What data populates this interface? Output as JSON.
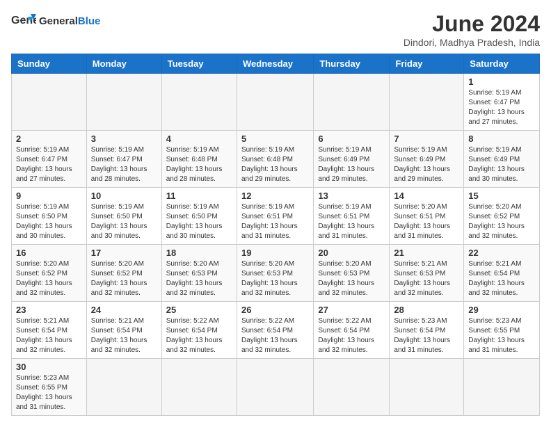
{
  "header": {
    "logo_general": "General",
    "logo_blue": "Blue",
    "month_year": "June 2024",
    "location": "Dindori, Madhya Pradesh, India"
  },
  "days_of_week": [
    "Sunday",
    "Monday",
    "Tuesday",
    "Wednesday",
    "Thursday",
    "Friday",
    "Saturday"
  ],
  "weeks": [
    [
      {
        "day": "",
        "info": ""
      },
      {
        "day": "",
        "info": ""
      },
      {
        "day": "",
        "info": ""
      },
      {
        "day": "",
        "info": ""
      },
      {
        "day": "",
        "info": ""
      },
      {
        "day": "",
        "info": ""
      },
      {
        "day": "1",
        "info": "Sunrise: 5:19 AM\nSunset: 6:47 PM\nDaylight: 13 hours and 27 minutes."
      }
    ],
    [
      {
        "day": "2",
        "info": "Sunrise: 5:19 AM\nSunset: 6:47 PM\nDaylight: 13 hours and 27 minutes."
      },
      {
        "day": "3",
        "info": "Sunrise: 5:19 AM\nSunset: 6:47 PM\nDaylight: 13 hours and 28 minutes."
      },
      {
        "day": "4",
        "info": "Sunrise: 5:19 AM\nSunset: 6:48 PM\nDaylight: 13 hours and 28 minutes."
      },
      {
        "day": "5",
        "info": "Sunrise: 5:19 AM\nSunset: 6:48 PM\nDaylight: 13 hours and 29 minutes."
      },
      {
        "day": "6",
        "info": "Sunrise: 5:19 AM\nSunset: 6:49 PM\nDaylight: 13 hours and 29 minutes."
      },
      {
        "day": "7",
        "info": "Sunrise: 5:19 AM\nSunset: 6:49 PM\nDaylight: 13 hours and 29 minutes."
      },
      {
        "day": "8",
        "info": "Sunrise: 5:19 AM\nSunset: 6:49 PM\nDaylight: 13 hours and 30 minutes."
      }
    ],
    [
      {
        "day": "9",
        "info": "Sunrise: 5:19 AM\nSunset: 6:50 PM\nDaylight: 13 hours and 30 minutes."
      },
      {
        "day": "10",
        "info": "Sunrise: 5:19 AM\nSunset: 6:50 PM\nDaylight: 13 hours and 30 minutes."
      },
      {
        "day": "11",
        "info": "Sunrise: 5:19 AM\nSunset: 6:50 PM\nDaylight: 13 hours and 30 minutes."
      },
      {
        "day": "12",
        "info": "Sunrise: 5:19 AM\nSunset: 6:51 PM\nDaylight: 13 hours and 31 minutes."
      },
      {
        "day": "13",
        "info": "Sunrise: 5:19 AM\nSunset: 6:51 PM\nDaylight: 13 hours and 31 minutes."
      },
      {
        "day": "14",
        "info": "Sunrise: 5:20 AM\nSunset: 6:51 PM\nDaylight: 13 hours and 31 minutes."
      },
      {
        "day": "15",
        "info": "Sunrise: 5:20 AM\nSunset: 6:52 PM\nDaylight: 13 hours and 32 minutes."
      }
    ],
    [
      {
        "day": "16",
        "info": "Sunrise: 5:20 AM\nSunset: 6:52 PM\nDaylight: 13 hours and 32 minutes."
      },
      {
        "day": "17",
        "info": "Sunrise: 5:20 AM\nSunset: 6:52 PM\nDaylight: 13 hours and 32 minutes."
      },
      {
        "day": "18",
        "info": "Sunrise: 5:20 AM\nSunset: 6:53 PM\nDaylight: 13 hours and 32 minutes."
      },
      {
        "day": "19",
        "info": "Sunrise: 5:20 AM\nSunset: 6:53 PM\nDaylight: 13 hours and 32 minutes."
      },
      {
        "day": "20",
        "info": "Sunrise: 5:20 AM\nSunset: 6:53 PM\nDaylight: 13 hours and 32 minutes."
      },
      {
        "day": "21",
        "info": "Sunrise: 5:21 AM\nSunset: 6:53 PM\nDaylight: 13 hours and 32 minutes."
      },
      {
        "day": "22",
        "info": "Sunrise: 5:21 AM\nSunset: 6:54 PM\nDaylight: 13 hours and 32 minutes."
      }
    ],
    [
      {
        "day": "23",
        "info": "Sunrise: 5:21 AM\nSunset: 6:54 PM\nDaylight: 13 hours and 32 minutes."
      },
      {
        "day": "24",
        "info": "Sunrise: 5:21 AM\nSunset: 6:54 PM\nDaylight: 13 hours and 32 minutes."
      },
      {
        "day": "25",
        "info": "Sunrise: 5:22 AM\nSunset: 6:54 PM\nDaylight: 13 hours and 32 minutes."
      },
      {
        "day": "26",
        "info": "Sunrise: 5:22 AM\nSunset: 6:54 PM\nDaylight: 13 hours and 32 minutes."
      },
      {
        "day": "27",
        "info": "Sunrise: 5:22 AM\nSunset: 6:54 PM\nDaylight: 13 hours and 32 minutes."
      },
      {
        "day": "28",
        "info": "Sunrise: 5:23 AM\nSunset: 6:54 PM\nDaylight: 13 hours and 31 minutes."
      },
      {
        "day": "29",
        "info": "Sunrise: 5:23 AM\nSunset: 6:55 PM\nDaylight: 13 hours and 31 minutes."
      }
    ],
    [
      {
        "day": "30",
        "info": "Sunrise: 5:23 AM\nSunset: 6:55 PM\nDaylight: 13 hours and 31 minutes."
      },
      {
        "day": "",
        "info": ""
      },
      {
        "day": "",
        "info": ""
      },
      {
        "day": "",
        "info": ""
      },
      {
        "day": "",
        "info": ""
      },
      {
        "day": "",
        "info": ""
      },
      {
        "day": "",
        "info": ""
      }
    ]
  ]
}
